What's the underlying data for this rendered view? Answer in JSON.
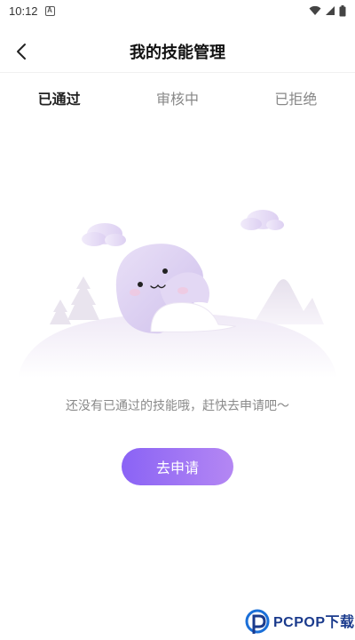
{
  "status_bar": {
    "time": "10:12",
    "notification_icon": "a-badge-icon",
    "wifi_icon": "wifi-icon",
    "signal_icon": "signal-icon",
    "battery_icon": "battery-icon"
  },
  "header": {
    "title": "我的技能管理",
    "back_icon": "chevron-left-icon"
  },
  "tabs": [
    {
      "label": "已通过",
      "active": true
    },
    {
      "label": "审核中",
      "active": false
    },
    {
      "label": "已拒绝",
      "active": false
    }
  ],
  "empty_state": {
    "illustration": "ghost-on-hill-illustration",
    "message": "还没有已通过的技能哦，赶快去申请吧～",
    "button_label": "去申请"
  },
  "watermark": {
    "text": "PCPOP下载"
  },
  "colors": {
    "accent_start": "#8a63f5",
    "accent_end": "#b487f3",
    "muted_text": "#8a8a8a"
  }
}
